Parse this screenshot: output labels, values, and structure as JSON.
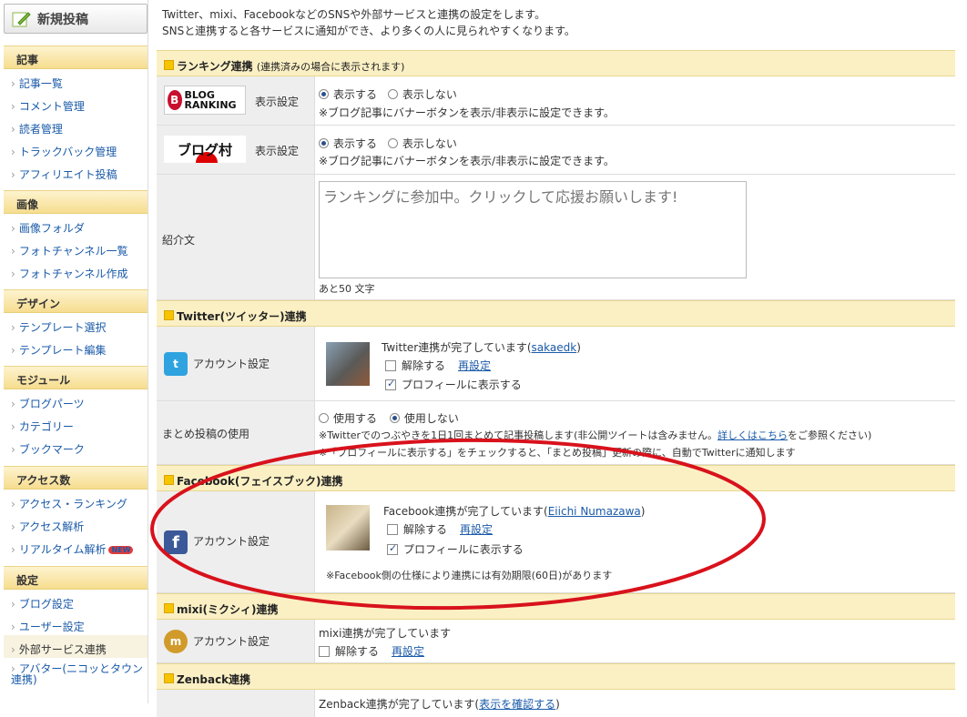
{
  "sidebar": {
    "new_post": "新規投稿",
    "sections": [
      {
        "title": "記事",
        "items": [
          "記事一覧",
          "コメント管理",
          "読者管理",
          "トラックバック管理",
          "アフィリエイト投稿"
        ]
      },
      {
        "title": "画像",
        "items": [
          "画像フォルダ",
          "フォトチャンネル一覧",
          "フォトチャンネル作成"
        ]
      },
      {
        "title": "デザイン",
        "items": [
          "テンプレート選択",
          "テンプレート編集"
        ]
      },
      {
        "title": "モジュール",
        "items": [
          "ブログパーツ",
          "カテゴリー",
          "ブックマーク"
        ]
      },
      {
        "title": "アクセス数",
        "items": [
          "アクセス・ランキング",
          "アクセス解析",
          "リアルタイム解析"
        ],
        "badge": "NEW"
      },
      {
        "title": "設定",
        "items": [
          "ブログ設定",
          "ユーザー設定",
          "外部サービス連携",
          "アバター(ニコッとタウン連携)"
        ]
      }
    ]
  },
  "intro": {
    "line1": "Twitter、mixi、FacebookなどのSNSや外部サービスと連携の設定をします。",
    "line2": "SNSと連携すると各サービスに通知ができ、より多くの人に見られやすくなります。"
  },
  "ranking": {
    "header": "ランキング連携",
    "header_note": "(連携済みの場合に表示されます)",
    "blogranking": {
      "logo": "BLOG RANKING",
      "label": "表示設定",
      "show": "表示する",
      "hide": "表示しない",
      "note": "※ブログ記事にバナーボタンを表示/非表示に設定できます。"
    },
    "blogmura": {
      "logo": "ブログ村",
      "label": "表示設定",
      "show": "表示する",
      "hide": "表示しない",
      "note": "※ブログ記事にバナーボタンを表示/非表示に設定できます。"
    },
    "intro_label": "紹介文",
    "intro_text": "ランキングに参加中。クリックして応援お願いします!",
    "remaining": "あと50 文字"
  },
  "twitter": {
    "header": "Twitter(ツイッター)連携",
    "label": "アカウント設定",
    "status_prefix": "Twitter連携が完了しています(",
    "user": "sakaedk",
    "status_suffix": ")",
    "release": "解除する",
    "reset": "再設定",
    "show_profile": "プロフィールに表示する",
    "summary_label": "まとめ投稿の使用",
    "use": "使用する",
    "not_use": "使用しない",
    "note1_a": "※Twitterでのつぶやきを1日1回まとめて記事投稿します(非公開ツイートは含みません。",
    "note1_link": "詳しくはこちら",
    "note1_b": "をご参照ください)",
    "note2": "※「プロフィールに表示する」をチェックすると、「まとめ投稿」更新の際に、自動でTwitterに通知します"
  },
  "facebook": {
    "header": "Facebook(フェイスブック)連携",
    "label": "アカウント設定",
    "status_prefix": "Facebook連携が完了しています(",
    "user": "Eiichi Numazawa",
    "status_suffix": ")",
    "release": "解除する",
    "reset": "再設定",
    "show_profile": "プロフィールに表示する",
    "note": "※Facebook側の仕様により連携には有効期限(60日)があります"
  },
  "mixi": {
    "header": "mixi(ミクシィ)連携",
    "label": "アカウント設定",
    "status": "mixi連携が完了しています",
    "release": "解除する",
    "reset": "再設定"
  },
  "zenback": {
    "header": "Zenback連携",
    "status_prefix": "Zenback連携が完了しています(",
    "link": "表示を確認する",
    "status_suffix": ")"
  },
  "colors": {
    "accent_red": "#d8121c",
    "header_bg": "#fbf0c4",
    "twitter": "#2fa3e0",
    "facebook": "#3b5998",
    "mixi": "#d19b2b"
  }
}
